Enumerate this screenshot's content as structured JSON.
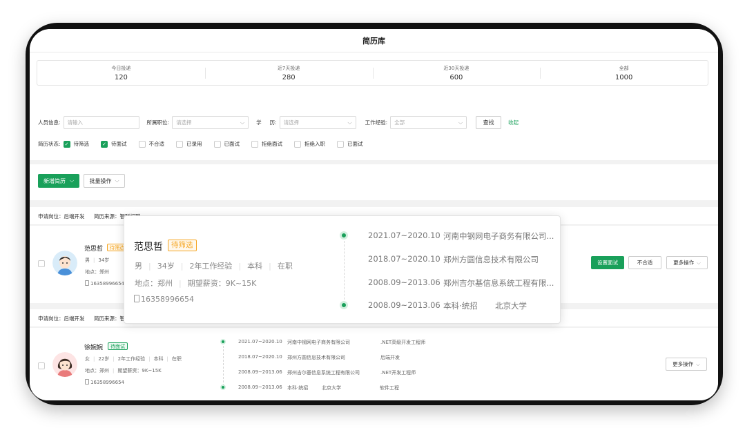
{
  "page": {
    "title": "简历库"
  },
  "stats": [
    {
      "label": "今日投递",
      "value": "120"
    },
    {
      "label": "近7天投递",
      "value": "280"
    },
    {
      "label": "近30天投递",
      "value": "600"
    },
    {
      "label": "全部",
      "value": "1000"
    }
  ],
  "filters": {
    "person_label": "人员信息:",
    "person_placeholder": "请输入",
    "position_label": "所属职位:",
    "position_placeholder": "请选择",
    "edu_label_1": "学",
    "edu_label_2": "历:",
    "edu_placeholder": "请选择",
    "exp_label": "工作经验:",
    "exp_value": "全部",
    "search_button": "查找",
    "collapse_link": "收起",
    "status_label": "简历状态:",
    "statuses": [
      {
        "label": "待筛选",
        "checked": true
      },
      {
        "label": "待面试",
        "checked": true
      },
      {
        "label": "不合适",
        "checked": false
      },
      {
        "label": "已录用",
        "checked": false
      },
      {
        "label": "已面试",
        "checked": false
      },
      {
        "label": "拒绝面试",
        "checked": false
      },
      {
        "label": "拒绝入职",
        "checked": false
      },
      {
        "label": "已面试",
        "checked": false
      }
    ]
  },
  "actions": {
    "new_resume": "新增简历",
    "batch": "批量操作"
  },
  "candidates": [
    {
      "apply_position": "申请岗位：后端开发",
      "source": "简历来源：智联招聘",
      "name": "范思哲",
      "status": "待筛选",
      "gender": "男",
      "age": "34岁",
      "experience": "2年工作经验",
      "location": "地点：郑州",
      "phone": "16358996654",
      "buttons": {
        "interview": "设置面试",
        "unfit": "不合适",
        "more": "更多操作"
      }
    },
    {
      "apply_position": "申请岗位：后端开发",
      "source": "简历来源：智",
      "name": "徐婉婉",
      "status": "待面试",
      "gender": "女",
      "age": "22岁",
      "experience": "2年工作经验",
      "education": "本科",
      "employment": "在职",
      "location": "地点：郑州",
      "salary": "期望薪资：9K~15K",
      "phone": "16358996654",
      "timeline": [
        {
          "period": "2021.07~2020.10",
          "org": "河南中钢网电子商务有限公司",
          "role": ".NET高级开发工程师"
        },
        {
          "period": "2018.07~2020.10",
          "org": "郑州方圆信息技术有限公司",
          "role": "后端开发"
        },
        {
          "period": "2008.09~2013.06",
          "org": "郑州吉尔基信息系统工程有限公司",
          "role": ".NET开发工程师"
        },
        {
          "period": "2008.09~2013.06",
          "org": "本科·统招",
          "school": "北京大学",
          "role": "软件工程"
        }
      ],
      "buttons": {
        "more": "更多操作"
      }
    }
  ],
  "popup": {
    "name": "范思哲",
    "status": "待筛选",
    "gender": "男",
    "age": "34岁",
    "experience": "2年工作经验",
    "education": "本科",
    "employment": "在职",
    "location": "地点：郑州",
    "salary": "期望薪资：9K~15K",
    "phone": "16358996654",
    "timeline": [
      {
        "period": "2021.07~2020.10",
        "org": "河南中钢网电子商务有限公司..."
      },
      {
        "period": "2018.07~2020.10",
        "org": "郑州方圆信息技术有限公司"
      },
      {
        "period": "2008.09~2013.06",
        "org": "郑州吉尔基信息系统工程有限..."
      },
      {
        "period": "2008.09~2013.06",
        "org": "本科·统招",
        "school": "北京大学"
      }
    ]
  },
  "colors": {
    "accent": "#19a05a",
    "pending": "#f5a623"
  }
}
